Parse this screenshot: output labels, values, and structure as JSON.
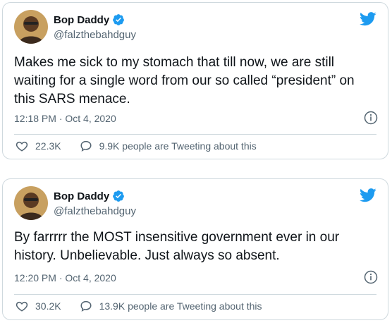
{
  "tweets": [
    {
      "name": "Bop Daddy",
      "handle": "@falzthebahdguy",
      "text": "Makes me sick to my stomach that till now, we are still waiting for a single word from our so called “president” on this SARS menace.",
      "timestamp": "12:18 PM · Oct 4, 2020",
      "likes": "22.3K",
      "tweeting": "9.9K people are Tweeting about this"
    },
    {
      "name": "Bop Daddy",
      "handle": "@falzthebahdguy",
      "text": "By farrrrr the MOST insensitive government ever in our history. Unbelievable. Just always so absent.",
      "timestamp": "12:20 PM · Oct 4, 2020",
      "likes": "30.2K",
      "tweeting": "13.9K people are Tweeting about this"
    }
  ],
  "icons": {
    "brand": "twitter-bird-icon",
    "verified": "verified-badge-icon",
    "info": "info-icon",
    "like": "heart-icon",
    "comment": "speech-bubble-icon"
  },
  "colors": {
    "accent": "#1d9bf0",
    "text": "#0f1419",
    "secondary": "#536471",
    "border": "#cfd9de"
  }
}
